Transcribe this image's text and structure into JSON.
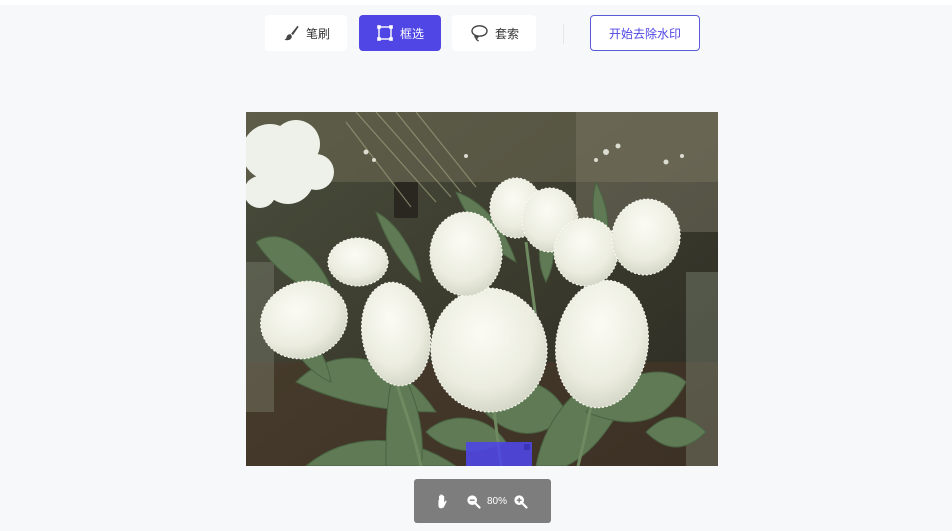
{
  "toolbar": {
    "tools": [
      {
        "label": "笔刷",
        "icon": "brush-icon",
        "active": false
      },
      {
        "label": "框选",
        "icon": "rect-select-icon",
        "active": true
      },
      {
        "label": "套索",
        "icon": "lasso-icon",
        "active": false
      }
    ],
    "start_label": "开始去除水印"
  },
  "canvas": {
    "subject": "white fringed tulips bouquet",
    "selection_color": "#4f46e5"
  },
  "zoom": {
    "value": "80%",
    "icons": [
      "hand-icon",
      "zoom-out-icon",
      "zoom-in-icon"
    ]
  },
  "colors": {
    "accent": "#4f46e5",
    "zoombar_bg": "#7d7d7d",
    "page_bg": "#f7f8fa"
  }
}
